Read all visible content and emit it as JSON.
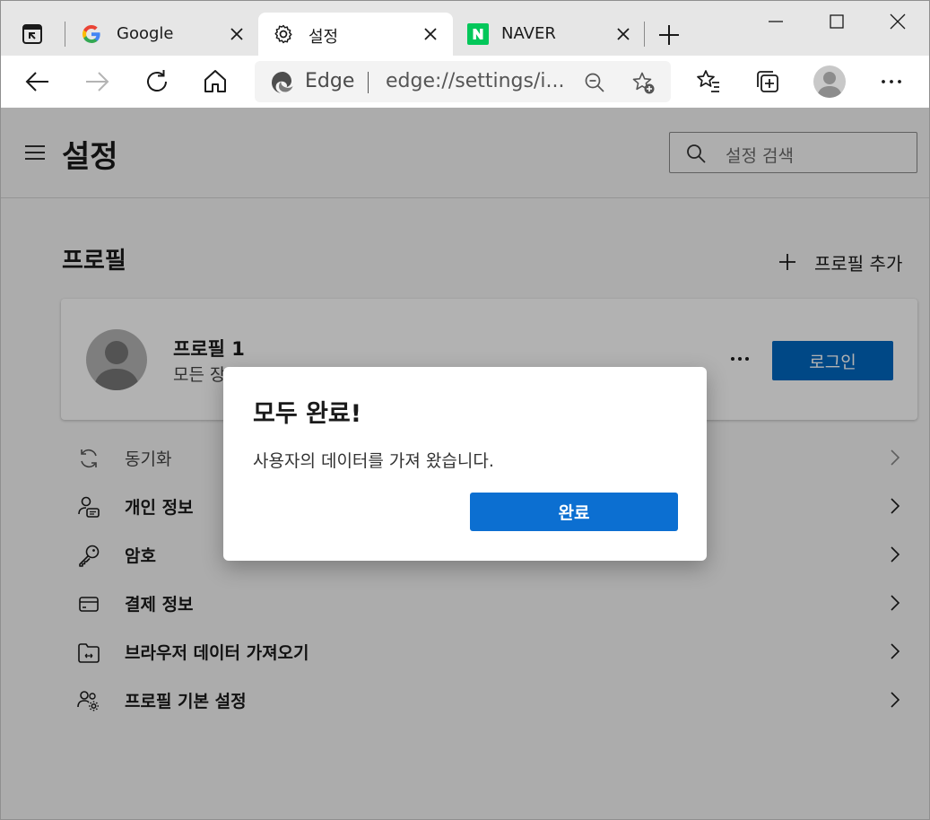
{
  "tabs": [
    {
      "title": "Google",
      "favicon": "google-g-icon"
    },
    {
      "title": "설정",
      "favicon": "gear-icon",
      "active": true
    },
    {
      "title": "NAVER",
      "favicon": "naver-n-icon"
    }
  ],
  "toolbar": {
    "edge_label": "Edge",
    "url": "edge://settings/i..."
  },
  "settings": {
    "title": "설정",
    "search_placeholder": "설정 검색",
    "section_title": "프로필",
    "add_profile_label": "프로필 추가",
    "profile": {
      "name": "프로필 1",
      "description": "모든 장",
      "login_label": "로그인"
    },
    "menu": [
      {
        "label": "동기화",
        "icon": "sync-icon"
      },
      {
        "label": "개인 정보",
        "icon": "personal-info-icon"
      },
      {
        "label": "암호",
        "icon": "key-icon"
      },
      {
        "label": "결제 정보",
        "icon": "card-icon"
      },
      {
        "label": "브라우저 데이터 가져오기",
        "icon": "import-folder-icon"
      },
      {
        "label": "프로필 기본 설정",
        "icon": "profile-settings-icon"
      }
    ]
  },
  "dialog": {
    "title": "모두 완료!",
    "message": "사용자의 데이터를 가져 왔습니다.",
    "button_label": "완료"
  },
  "colors": {
    "accent": "#0067c0",
    "dialog_button": "#0c6fd1",
    "overlay": "rgba(0,0,0,0.30)"
  }
}
